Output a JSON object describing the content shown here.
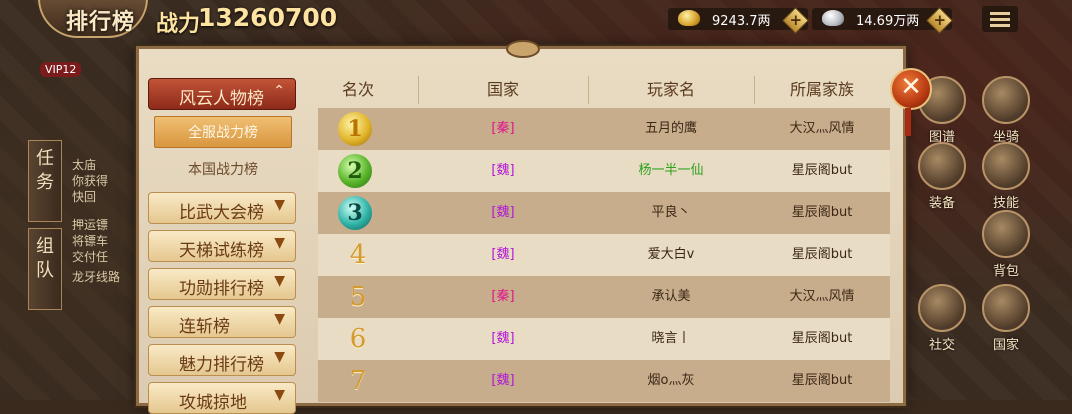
{
  "header": {
    "title": "排行榜",
    "power_label": "战力",
    "power_value": "13260700",
    "vip": "VIP12"
  },
  "currency": {
    "gold": {
      "value": "9243.7两",
      "icon": "gold-ingot-icon"
    },
    "silver": {
      "value": "14.69万两",
      "icon": "silver-ingot-icon"
    }
  },
  "hud_left": {
    "tabs": [
      {
        "label": "任务"
      },
      {
        "label": "组队"
      }
    ],
    "quests": [
      "太庙",
      "你获得",
      "快回",
      "押运镖",
      "将镖车",
      "交付任",
      "龙牙线路"
    ]
  },
  "hud_right": {
    "icons": [
      {
        "label": "图谱",
        "icon": "map-icon"
      },
      {
        "label": "坐骑",
        "icon": "mount-icon"
      },
      {
        "label": "装备",
        "icon": "equipment-icon"
      },
      {
        "label": "技能",
        "icon": "skill-icon"
      },
      {
        "label": "背包",
        "icon": "bag-icon"
      },
      {
        "label": "社交",
        "icon": "social-icon"
      },
      {
        "label": "国家",
        "icon": "nation-icon"
      }
    ]
  },
  "categories": {
    "open": {
      "label": "风云人物榜",
      "chevron": "⌃"
    },
    "subs": [
      {
        "label": "全服战力榜",
        "active": true
      },
      {
        "label": "本国战力榜",
        "active": false
      }
    ],
    "others": [
      {
        "label": "比武大会榜"
      },
      {
        "label": "天梯试练榜"
      },
      {
        "label": "功勋排行榜"
      },
      {
        "label": "连斩榜"
      },
      {
        "label": "魅力排行榜"
      },
      {
        "label": "攻城掠地"
      }
    ]
  },
  "table": {
    "headers": {
      "rank": "名次",
      "nation": "国家",
      "name": "玩家名",
      "clan": "所属家族"
    },
    "rows": [
      {
        "rank": "1",
        "nation": "[秦]",
        "name": "五月的鹰",
        "clan": "大汉灬风情"
      },
      {
        "rank": "2",
        "nation": "[魏]",
        "name": "杨一半一仙",
        "clan": "星辰阁but"
      },
      {
        "rank": "3",
        "nation": "[魏]",
        "name": "平良丶",
        "clan": "星辰阁but"
      },
      {
        "rank": "4",
        "nation": "[魏]",
        "name": "爱大白v",
        "clan": "星辰阁but"
      },
      {
        "rank": "5",
        "nation": "[秦]",
        "name": "承认美",
        "clan": "大汉灬风情"
      },
      {
        "rank": "6",
        "nation": "[魏]",
        "name": "晓言丨",
        "clan": "星辰阁but"
      },
      {
        "rank": "7",
        "nation": "[魏]",
        "name": "烟o灬灰",
        "clan": "星辰阁but"
      }
    ]
  },
  "close": {
    "label": "✕"
  }
}
